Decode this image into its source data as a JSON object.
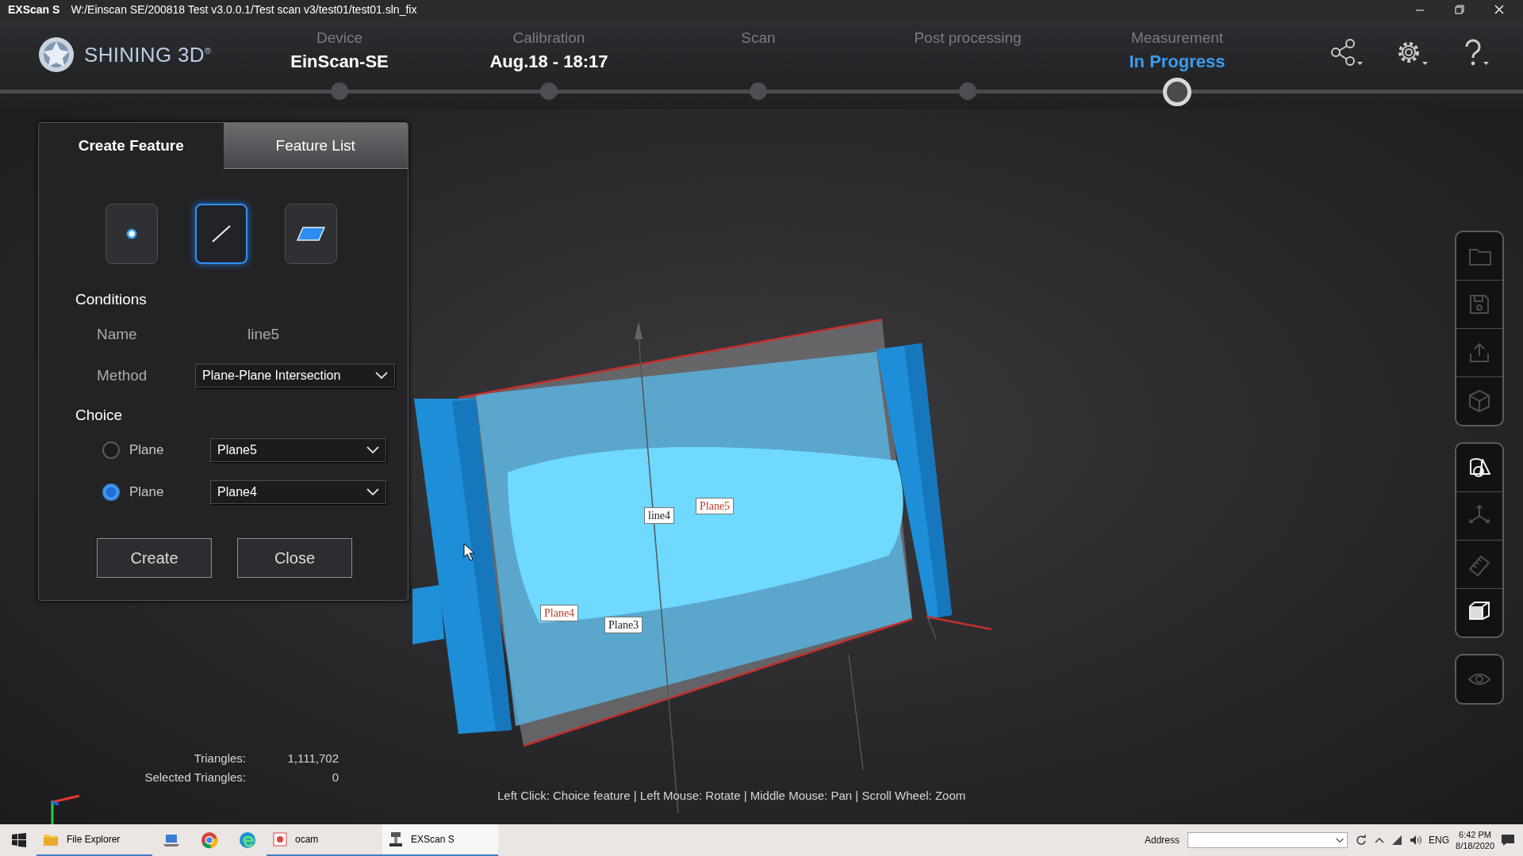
{
  "window": {
    "app": "EXScan S",
    "path": "W:/Einscan SE/200818 Test v3.0.0.1/Test scan v3/test01/test01.sln_fix"
  },
  "header": {
    "logo": "SHINING 3D$^{®}$",
    "steps": [
      {
        "caption": "Device",
        "value": "EinScan-SE",
        "selected": false
      },
      {
        "caption": "Calibration",
        "value": "Aug.18 - 18:17",
        "selected": false
      },
      {
        "caption": "Scan",
        "selected": false
      },
      {
        "caption": "Post processing",
        "selected": false
      },
      {
        "caption": "Measurement",
        "value": "In Progress",
        "selected": true
      }
    ]
  },
  "panel": {
    "tabs": [
      {
        "label": "Create Feature",
        "selected": true
      },
      {
        "label": "Feature List",
        "selected": false
      }
    ],
    "feature_types": [
      {
        "kind": "point",
        "selected": false
      },
      {
        "kind": "line",
        "selected": true
      },
      {
        "kind": "plane",
        "selected": false
      }
    ],
    "conditions": {
      "heading": "Conditions",
      "name_label": "Name",
      "name_value": "line5",
      "method_label": "Method",
      "method_value": "Plane-Plane Intersection"
    },
    "choice": {
      "heading": "Choice",
      "rows": [
        {
          "label": "Plane",
          "value": "Plane5",
          "selected": false
        },
        {
          "label": "Plane",
          "value": "Plane4",
          "selected": true
        }
      ]
    },
    "buttons": [
      "Create",
      "Close"
    ]
  },
  "viewport": {
    "labels": [
      {
        "text": "line4",
        "selected": false
      },
      {
        "text": "Plane5",
        "selected": true
      },
      {
        "text": "Plane4",
        "selected": true
      },
      {
        "text": "Plane3",
        "selected": false
      }
    ],
    "stats": [
      {
        "label": "Triangles:",
        "value": "1,111,702"
      },
      {
        "label": "Selected Triangles:",
        "value": "0"
      }
    ],
    "hint": "Left Click: Choice feature | Left Mouse: Rotate | Middle Mouse: Pan | Scroll Wheel: Zoom"
  },
  "toolbar": [
    [
      {
        "kind": "folder",
        "enabled": false
      },
      {
        "kind": "save",
        "enabled": false
      },
      {
        "kind": "export",
        "enabled": false
      },
      {
        "kind": "cube",
        "enabled": false
      }
    ],
    [
      {
        "kind": "shapes",
        "enabled": true
      },
      {
        "kind": "axes",
        "enabled": false
      },
      {
        "kind": "ruler",
        "enabled": false
      },
      {
        "kind": "box",
        "enabled": true
      }
    ],
    [
      {
        "kind": "eye",
        "enabled": false
      }
    ]
  ],
  "taskbar": {
    "items": [
      {
        "kind": "explorer",
        "label": "File Explorer",
        "running": true,
        "selected": false
      },
      {
        "kind": "laptop",
        "running": false,
        "selected": false
      },
      {
        "kind": "chrome",
        "running": false,
        "selected": false
      },
      {
        "kind": "edge",
        "running": false,
        "selected": false
      },
      {
        "kind": "ocam",
        "label": "ocam",
        "running": true,
        "selected": false
      },
      {
        "kind": "exscan",
        "label": "EXScan S",
        "running": true,
        "selected": true
      }
    ],
    "address_label": "Address",
    "language": "ENG",
    "time": "6:42 PM",
    "date": "8/18/2020"
  }
}
